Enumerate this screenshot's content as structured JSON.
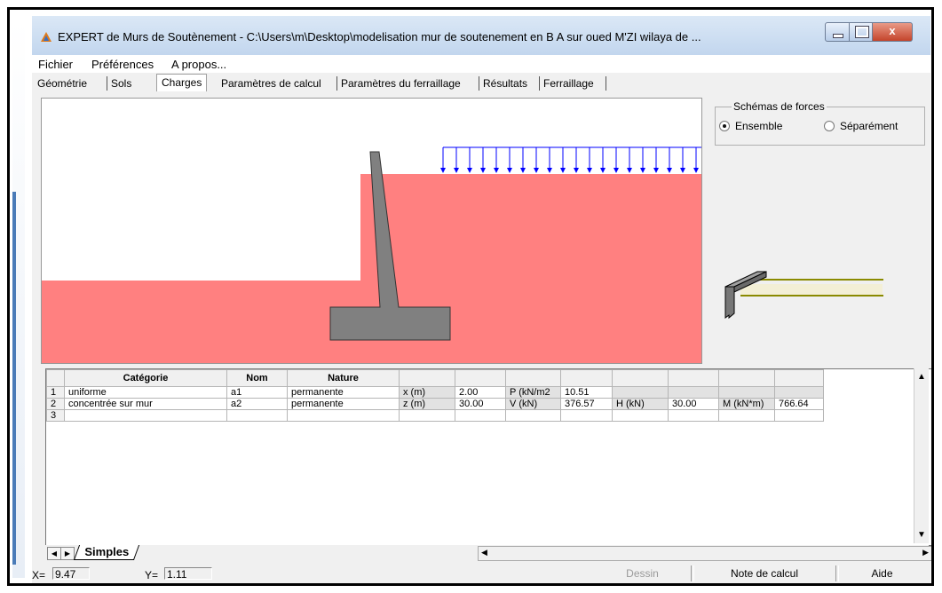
{
  "window": {
    "title": "EXPERT de Murs de Soutènement - C:\\Users\\m\\Desktop\\modelisation mur de soutenement en B A sur oued M'ZI wilaya de ...",
    "close_glyph": "x"
  },
  "menu": [
    "Fichier",
    "Préférences",
    "A propos..."
  ],
  "tabs": [
    "Géométrie",
    "Sols",
    "Charges",
    "Paramètres de calcul",
    "Paramètres du ferraillage",
    "Résultats",
    "Ferraillage"
  ],
  "active_tab": "Charges",
  "schema": {
    "title": "Schémas de forces",
    "options": [
      {
        "label": "Ensemble",
        "selected": true
      },
      {
        "label": "Séparément",
        "selected": false
      }
    ]
  },
  "drawing": {
    "soil_color": "#ff8080",
    "wall_color": "#808080",
    "load_color": "#0000ff",
    "load_arrow_count": 20
  },
  "grid": {
    "headers": [
      "",
      "Catégorie",
      "Nom",
      "Nature",
      "",
      "",
      "",
      "",
      "",
      "",
      "",
      ""
    ],
    "rows": [
      [
        "1",
        "uniforme",
        "a1",
        "permanente",
        "x (m)",
        "2.00",
        "P (kN/m2",
        "10.51",
        "",
        "",
        "",
        ""
      ],
      [
        "2",
        "concentrée sur mur",
        "a2",
        "permanente",
        "z (m)",
        "30.00",
        "V (kN)",
        "376.57",
        "H (kN)",
        "30.00",
        "M (kN*m)",
        "766.64"
      ],
      [
        "3",
        "",
        "",
        "",
        "",
        "",
        "",
        "",
        "",
        "",
        "",
        ""
      ]
    ]
  },
  "sheet_tab": "Simples",
  "status": {
    "x_label": "X=",
    "x_value": "9.47",
    "y_label": "Y=",
    "y_value": "1.11",
    "buttons": [
      "Dessin",
      "Note de calcul",
      "Aide"
    ]
  }
}
